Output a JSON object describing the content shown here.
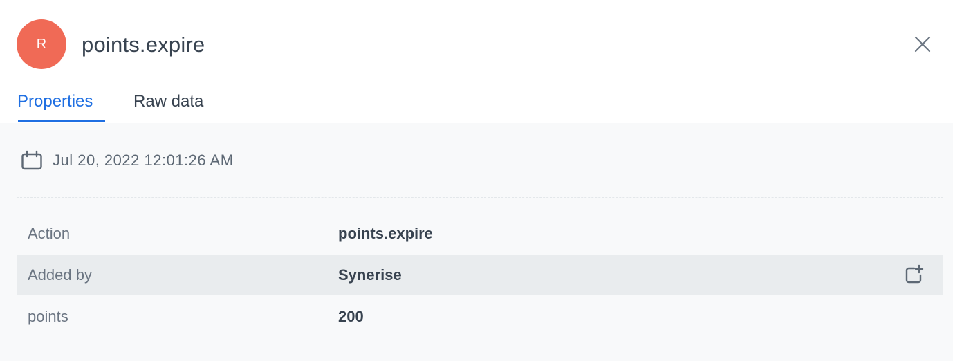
{
  "header": {
    "avatar_initial": "R",
    "avatar_color": "#f06a56",
    "title": "points.expire",
    "close_icon": "close-icon"
  },
  "tabs": [
    {
      "label": "Properties",
      "active": true
    },
    {
      "label": "Raw data",
      "active": false
    }
  ],
  "event": {
    "date_icon": "calendar-icon",
    "timestamp": "Jul 20, 2022 12:01:26 AM"
  },
  "properties": [
    {
      "key": "Action",
      "value": "points.expire"
    },
    {
      "key": "Added by",
      "value": "Synerise",
      "action_icon": "add-to-filter-icon"
    },
    {
      "key": "points",
      "value": "200"
    }
  ],
  "colors": {
    "accent": "#1f6fe2",
    "text": "#384350",
    "muted": "#6b7582",
    "highlight_row": "#e9ecee"
  }
}
